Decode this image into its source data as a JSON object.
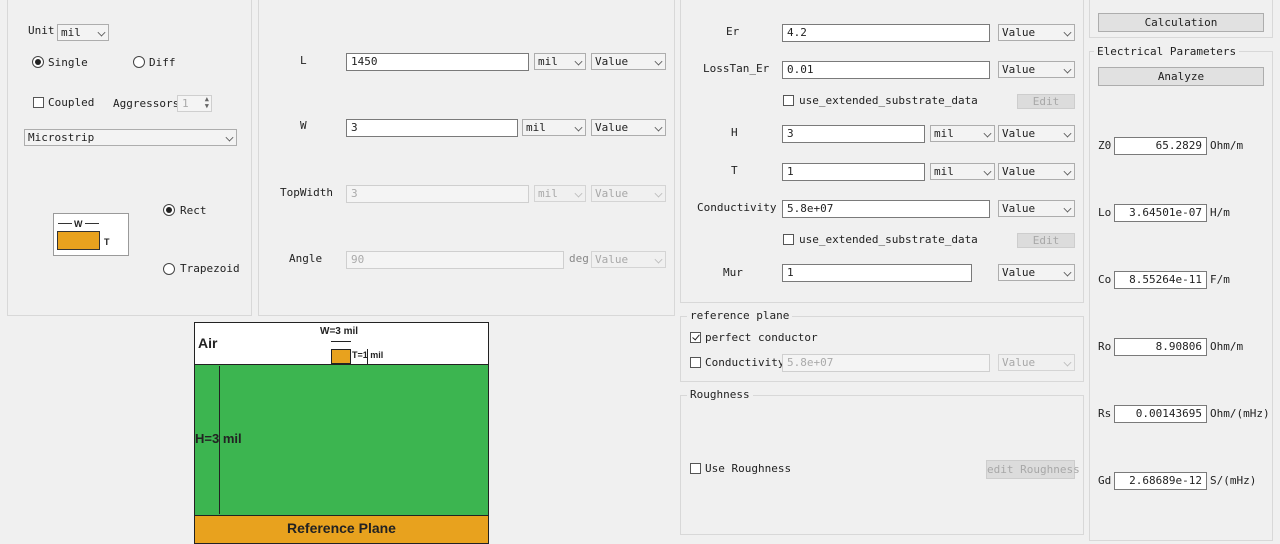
{
  "left_panel": {
    "unit_label": "Unit",
    "unit_value": "mil",
    "single_label": "Single",
    "diff_label": "Diff",
    "coupled_label": "Coupled",
    "aggressors_label": "Aggressors",
    "aggressors_value": "1",
    "structure_value": "Microstrip",
    "rect_label": "Rect",
    "trapezoid_label": "Trapezoid",
    "icon_w": "W",
    "icon_t": "T"
  },
  "physical": {
    "l_label": "L",
    "l_value": "1450",
    "l_unit": "mil",
    "l_mode": "Value",
    "w_label": "W",
    "w_value": "3",
    "w_unit": "mil",
    "w_mode": "Value",
    "topwidth_label": "TopWidth",
    "topwidth_value": "3",
    "topwidth_unit": "mil",
    "topwidth_mode": "Value",
    "angle_label": "Angle",
    "angle_value": "90",
    "angle_unit": "deg",
    "angle_mode": "Value"
  },
  "substrate": {
    "er_label": "Er",
    "er_value": "4.2",
    "er_mode": "Value",
    "losstan_label": "LossTan_Er",
    "losstan_value": "0.01",
    "losstan_mode": "Value",
    "ext1_label": "use_extended_substrate_data",
    "edit1_label": "Edit",
    "h_label": "H",
    "h_value": "3",
    "h_unit": "mil",
    "h_mode": "Value",
    "t_label": "T",
    "t_value": "1",
    "t_unit": "mil",
    "t_mode": "Value",
    "cond_label": "Conductivity",
    "cond_value": "5.8e+07",
    "cond_mode": "Value",
    "ext2_label": "use_extended_substrate_data",
    "edit2_label": "Edit",
    "mur_label": "Mur",
    "mur_value": "1",
    "mur_mode": "Value"
  },
  "reference_plane": {
    "title": "reference plane",
    "perfect_label": "perfect conductor",
    "cond_label": "Conductivity",
    "cond_value": "5.8e+07",
    "cond_mode": "Value"
  },
  "roughness": {
    "title": "Roughness",
    "use_label": "Use Roughness",
    "edit_label": "edit Roughness"
  },
  "calc": {
    "button": "Calculation"
  },
  "electrical": {
    "title": "Electrical Parameters",
    "analyze": "Analyze",
    "rows": [
      {
        "label": "Z0",
        "value": "65.2829",
        "unit": "Ohm/m"
      },
      {
        "label": "Lo",
        "value": "3.64501e-07",
        "unit": "H/m"
      },
      {
        "label": "Co",
        "value": "8.55264e-11",
        "unit": "F/m"
      },
      {
        "label": "Ro",
        "value": "8.90806",
        "unit": "Ohm/m"
      },
      {
        "label": "Rs",
        "value": "0.00143695",
        "unit": "Ohm/(mHz)"
      },
      {
        "label": "Gd",
        "value": "2.68689e-12",
        "unit": "S/(mHz)"
      }
    ]
  },
  "diagram": {
    "air": "Air",
    "w_label": "W=3 mil",
    "t_label": "T=1 mil",
    "h_label": "H=3 mil",
    "ref_plane": "Reference Plane",
    "colors": {
      "substrate": "#3cb550",
      "metal": "#e8a21e",
      "air": "#ffffff"
    }
  }
}
